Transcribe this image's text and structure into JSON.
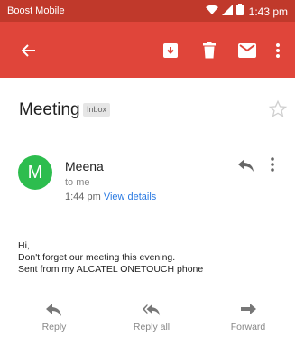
{
  "status_bar": {
    "carrier": "Boost Mobile",
    "time": "1:43 pm"
  },
  "email": {
    "subject": "Meeting",
    "label": "Inbox",
    "sender": {
      "name": "Meena",
      "initial": "M",
      "to": "to me",
      "time": "1:44 pm",
      "view_details": "View details"
    },
    "body": [
      "Hi,",
      "Don't forget our meeting this evening.",
      "Sent from my ALCATEL ONETOUCH phone"
    ]
  },
  "actions": {
    "reply": "Reply",
    "reply_all": "Reply all",
    "forward": "Forward"
  },
  "colors": {
    "app_bar": "#e0453a",
    "status_bar": "#c0392b",
    "avatar": "#2dbd4e",
    "link": "#2a7ae2"
  }
}
